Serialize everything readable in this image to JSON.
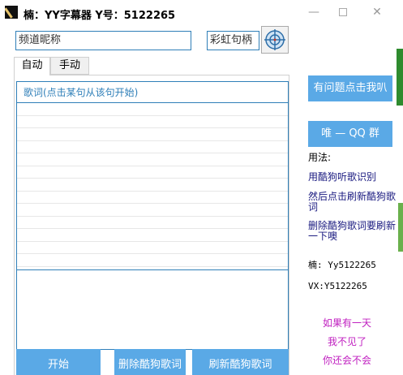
{
  "window": {
    "title": "楠：YY字幕器  Y号：5122265",
    "controls": {
      "minimize": "—",
      "close": "✕"
    }
  },
  "inputs": {
    "channel_placeholder": "频道昵称",
    "rainbow_value": "彩虹句柄"
  },
  "tabs": [
    {
      "label": "自动"
    },
    {
      "label": "手动"
    }
  ],
  "lyrics": {
    "header": "歌词(点击某句从该句开始)"
  },
  "buttons": {
    "start": "开始",
    "delete_lyrics": "删除酷狗歌词",
    "refresh_lyrics": "刷新酷狗歌词",
    "help": "有问题点击我叭",
    "qq_group": "唯 — QQ 群"
  },
  "sidebar": {
    "usage_title": "用法:",
    "usage_steps": [
      "用酷狗听歌识别",
      "然后点击刷新酷狗歌词",
      "删除酷狗歌词要刷新一下噢"
    ],
    "contact_nan": "楠: Yy5122265",
    "contact_vx": "VX:Y5122265",
    "poem": [
      "如果有一天",
      "我不见了",
      "你还会不会"
    ]
  }
}
